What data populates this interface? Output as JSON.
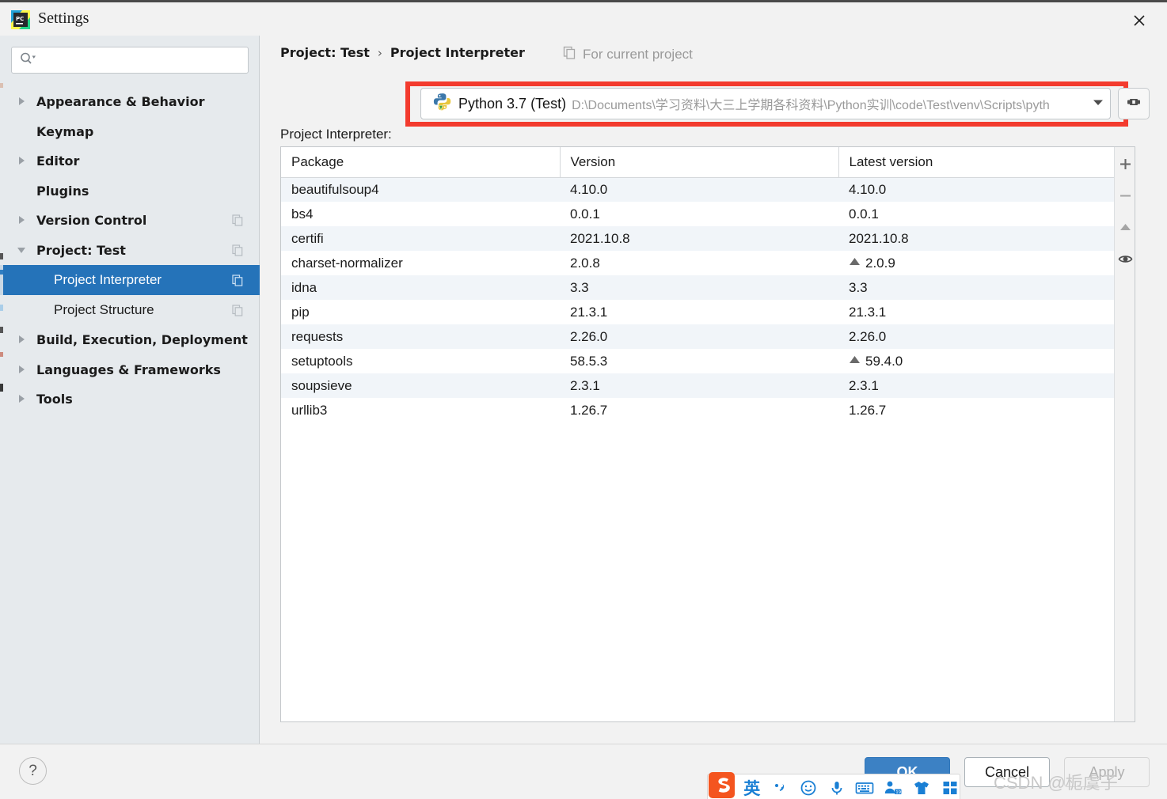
{
  "window": {
    "title": "Settings",
    "app_icon": "pycharm-icon",
    "close_label": "✕"
  },
  "sidebar": {
    "search": {
      "value": "",
      "placeholder": "",
      "icon": "search-icon"
    },
    "items": [
      {
        "label": "Appearance & Behavior",
        "level": "top",
        "arrow": "right",
        "badge": false,
        "selected": false
      },
      {
        "label": "Keymap",
        "level": "top",
        "arrow": "none",
        "badge": false,
        "selected": false
      },
      {
        "label": "Editor",
        "level": "top",
        "arrow": "right",
        "badge": false,
        "selected": false
      },
      {
        "label": "Plugins",
        "level": "top",
        "arrow": "none",
        "badge": false,
        "selected": false
      },
      {
        "label": "Version Control",
        "level": "top",
        "arrow": "right",
        "badge": true,
        "selected": false
      },
      {
        "label": "Project: Test",
        "level": "top",
        "arrow": "down",
        "badge": true,
        "selected": false
      },
      {
        "label": "Project Interpreter",
        "level": "child",
        "arrow": "none",
        "badge": true,
        "selected": true
      },
      {
        "label": "Project Structure",
        "level": "child",
        "arrow": "none",
        "badge": true,
        "selected": false
      },
      {
        "label": "Build, Execution, Deployment",
        "level": "top",
        "arrow": "right",
        "badge": false,
        "selected": false
      },
      {
        "label": "Languages & Frameworks",
        "level": "top",
        "arrow": "right",
        "badge": false,
        "selected": false
      },
      {
        "label": "Tools",
        "level": "top",
        "arrow": "right",
        "badge": false,
        "selected": false
      }
    ]
  },
  "main": {
    "breadcrumb": {
      "parent": "Project: Test",
      "separator": "›",
      "current": "Project Interpreter"
    },
    "for_current_project": "For current project",
    "interpreter": {
      "field_label": "Project Interpreter:",
      "icon": "python-venv-icon",
      "name": "Python 3.7 (Test)",
      "path": "D:\\Documents\\学习资料\\大三上学期各科资料\\Python实训\\code\\Test\\venv\\Scripts\\pyth",
      "dropdown_icon": "chevron-down-icon",
      "settings_icon": "gear-icon",
      "highlight_color": "#f33b2e"
    },
    "table": {
      "columns": [
        "Package",
        "Version",
        "Latest version"
      ],
      "rows": [
        {
          "package": "beautifulsoup4",
          "version": "4.10.0",
          "latest": "4.10.0",
          "upgradable": false
        },
        {
          "package": "bs4",
          "version": "0.0.1",
          "latest": "0.0.1",
          "upgradable": false
        },
        {
          "package": "certifi",
          "version": "2021.10.8",
          "latest": "2021.10.8",
          "upgradable": false
        },
        {
          "package": "charset-normalizer",
          "version": "2.0.8",
          "latest": "2.0.9",
          "upgradable": true
        },
        {
          "package": "idna",
          "version": "3.3",
          "latest": "3.3",
          "upgradable": false
        },
        {
          "package": "pip",
          "version": "21.3.1",
          "latest": "21.3.1",
          "upgradable": false
        },
        {
          "package": "requests",
          "version": "2.26.0",
          "latest": "2.26.0",
          "upgradable": false
        },
        {
          "package": "setuptools",
          "version": "58.5.3",
          "latest": "59.4.0",
          "upgradable": true
        },
        {
          "package": "soupsieve",
          "version": "2.3.1",
          "latest": "2.3.1",
          "upgradable": false
        },
        {
          "package": "urllib3",
          "version": "1.26.7",
          "latest": "1.26.7",
          "upgradable": false
        }
      ]
    },
    "table_actions": [
      {
        "name": "add-package-button",
        "icon": "plus-icon"
      },
      {
        "name": "remove-package-button",
        "icon": "minus-icon"
      },
      {
        "name": "upgrade-package-button",
        "icon": "up-arrow-icon"
      },
      {
        "name": "show-early-releases-button",
        "icon": "eye-icon"
      }
    ]
  },
  "footer": {
    "help_label": "?",
    "ok_label": "OK",
    "cancel_label": "Cancel",
    "apply_label": "Apply",
    "apply_enabled": false,
    "accent_color": "#3c81c4"
  },
  "overlay": {
    "ime": {
      "logo": "sogou-logo-icon",
      "mode_label": "英",
      "items": [
        "punctuation-icon",
        "emoji-icon",
        "microphone-icon",
        "keyboard-icon",
        "account-icon",
        "skin-icon",
        "apps-icon"
      ]
    },
    "watermark": "CSDN @栀虞子"
  }
}
